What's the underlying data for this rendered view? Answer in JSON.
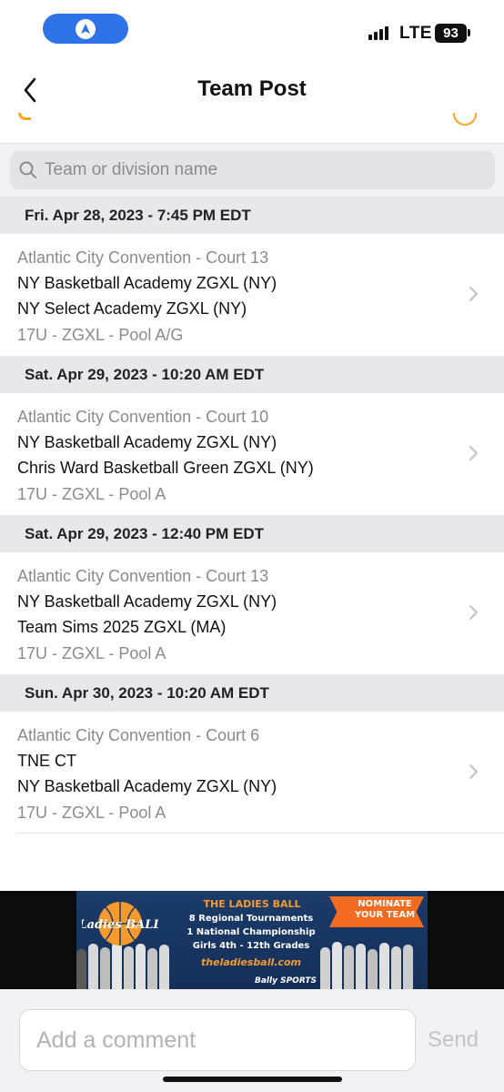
{
  "status_bar": {
    "network": "LTE",
    "battery": "93"
  },
  "header": {
    "title": "Team Post"
  },
  "search": {
    "placeholder": "Team or division name",
    "value": ""
  },
  "schedule": [
    {
      "date": "Fri. Apr 28, 2023 - 7:45 PM EDT",
      "venue": "Atlantic City Convention - Court 13",
      "team1": "NY Basketball Academy ZGXL (NY)",
      "team2": "NY Select Academy ZGXL (NY)",
      "division": "17U - ZGXL - Pool A/G"
    },
    {
      "date": "Sat. Apr 29, 2023 - 10:20 AM EDT",
      "venue": "Atlantic City Convention - Court 10",
      "team1": "NY Basketball Academy ZGXL (NY)",
      "team2": "Chris Ward Basketball Green ZGXL (NY)",
      "division": "17U - ZGXL - Pool A"
    },
    {
      "date": "Sat. Apr 29, 2023 - 12:40 PM EDT",
      "venue": "Atlantic City Convention - Court 13",
      "team1": "NY Basketball Academy ZGXL (NY)",
      "team2": "Team Sims 2025 ZGXL (MA)",
      "division": "17U - ZGXL - Pool A"
    },
    {
      "date": "Sun. Apr 30, 2023 - 10:20 AM EDT",
      "venue": "Atlantic City Convention - Court 6",
      "team1": "TNE CT",
      "team2": "NY Basketball Academy ZGXL (NY)",
      "division": "17U - ZGXL - Pool A"
    }
  ],
  "ad": {
    "logo_text": "Ladies BALL",
    "title": "THE LADIES BALL",
    "line1": "8 Regional Tournaments",
    "line2": "1 National Championship",
    "line3": "Girls 4th - 12th Grades",
    "url": "theladiesball.com",
    "cta": "NOMINATE YOUR TEAM",
    "sponsor": "Bally SPORTS",
    "accent_color": "#f79a2c",
    "bg_color": "#1c3b6a"
  },
  "comment": {
    "placeholder": "Add a comment",
    "send_label": "Send"
  },
  "colors": {
    "nav_pill": "#2f73e8",
    "accent": "#f5a623"
  }
}
